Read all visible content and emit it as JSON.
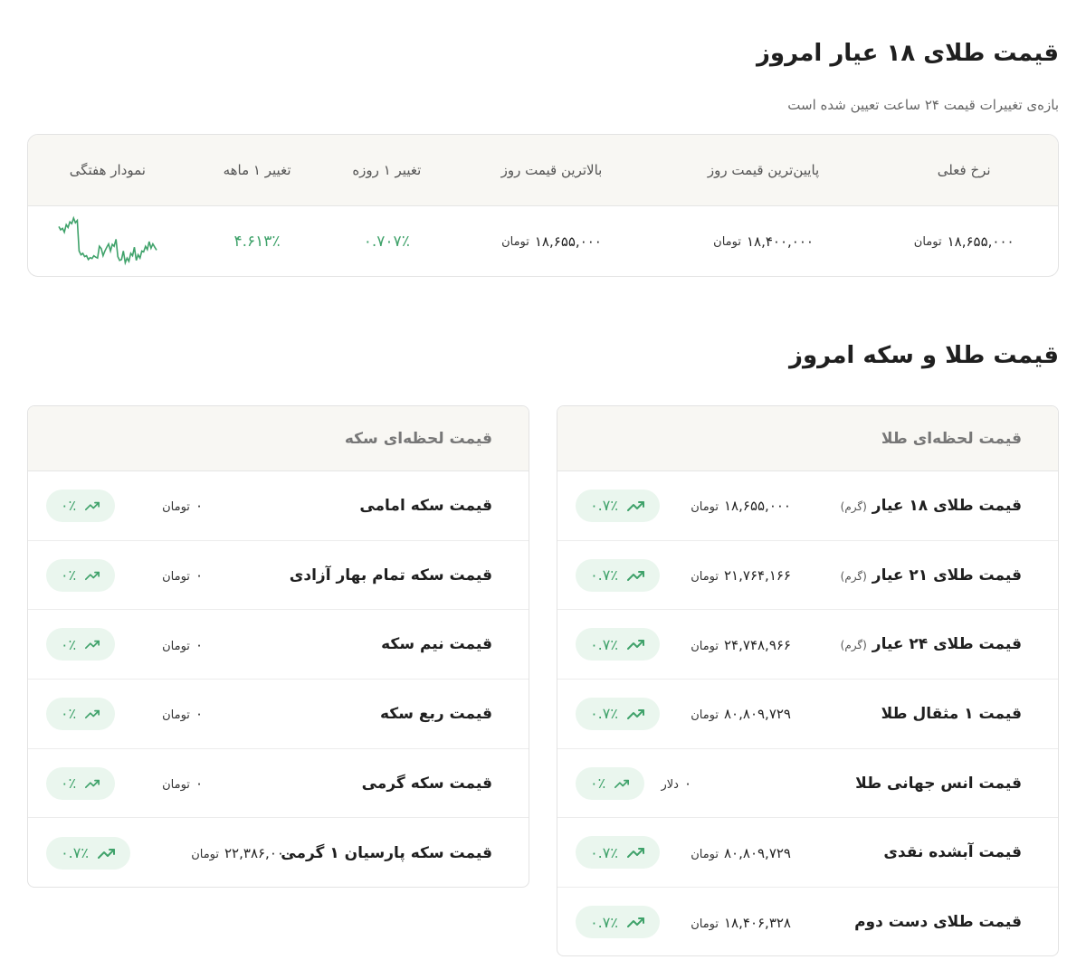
{
  "section1": {
    "title": "قیمت طلای ۱۸ عیار امروز",
    "subtitle": "بازه‌ی تغییرات قیمت ۲۴ ساعت تعیین شده است",
    "headers": {
      "current": "نرخ فعلی",
      "lowest": "پایین‌ترین قیمت روز",
      "highest": "بالاترین قیمت روز",
      "change_day": "تغییر ۱ روزه",
      "change_month": "تغییر ۱ ماهه",
      "weekly_chart": "نمودار هفتگی"
    },
    "row": {
      "current": "۱۸,۶۵۵,۰۰۰",
      "lowest": "۱۸,۴۰۰,۰۰۰",
      "highest": "۱۸,۶۵۵,۰۰۰",
      "unit": "تومان",
      "change_day": "۰.۷۰۷٪",
      "change_month": "۴.۶۱۳٪"
    },
    "sparkline": {
      "color": "#3fa26a",
      "values": [
        0.82,
        0.75,
        0.78,
        0.7,
        0.86,
        0.8,
        0.92,
        0.88,
        1.0,
        0.9,
        0.95,
        0.3,
        0.22,
        0.25,
        0.18,
        0.2,
        0.12,
        0.16,
        0.14,
        0.2,
        0.17,
        0.15,
        0.4,
        0.35,
        0.2,
        0.3,
        0.38,
        0.45,
        0.3,
        0.44,
        0.4,
        0.55,
        0.18,
        0.1,
        0.12,
        0.3,
        0.05,
        0.15,
        0.08,
        0.25,
        0.2,
        0.38,
        0.1,
        0.22,
        0.15,
        0.3,
        0.28,
        0.4,
        0.33,
        0.5,
        0.36,
        0.45,
        0.38,
        0.32
      ]
    }
  },
  "section2": {
    "title": "قیمت طلا و سکه امروز"
  },
  "gold_panel": {
    "title": "قیمت لحظه‌ای طلا",
    "rows": [
      {
        "name": "قیمت طلای ۱۸ عیار",
        "suffix": "(گرم)",
        "price": "۱۸,۶۵۵,۰۰۰",
        "unit": "تومان",
        "change": "۰.۷٪"
      },
      {
        "name": "قیمت طلای ۲۱ عیار",
        "suffix": "(گرم)",
        "price": "۲۱,۷۶۴,۱۶۶",
        "unit": "تومان",
        "change": "۰.۷٪"
      },
      {
        "name": "قیمت طلای ۲۴ عیار",
        "suffix": "(گرم)",
        "price": "۲۴,۷۴۸,۹۶۶",
        "unit": "تومان",
        "change": "۰.۷٪"
      },
      {
        "name": "قیمت ۱ مثقال طلا",
        "suffix": "",
        "price": "۸۰,۸۰۹,۷۲۹",
        "unit": "تومان",
        "change": "۰.۷٪"
      },
      {
        "name": "قیمت انس جهانی طلا",
        "suffix": "",
        "price": "۰",
        "unit": "دلار",
        "change": "۰٪"
      },
      {
        "name": "قیمت آبشده نقدی",
        "suffix": "",
        "price": "۸۰,۸۰۹,۷۲۹",
        "unit": "تومان",
        "change": "۰.۷٪"
      },
      {
        "name": "قیمت طلای دست دوم",
        "suffix": "",
        "price": "۱۸,۴۰۶,۳۲۸",
        "unit": "تومان",
        "change": "۰.۷٪"
      }
    ]
  },
  "coin_panel": {
    "title": "قیمت لحظه‌ای سکه",
    "rows": [
      {
        "name": "قیمت سکه امامی",
        "price": "۰",
        "unit": "تومان",
        "change": "۰٪"
      },
      {
        "name": "قیمت سکه تمام بهار آزادی",
        "price": "۰",
        "unit": "تومان",
        "change": "۰٪"
      },
      {
        "name": "قیمت نیم سکه",
        "price": "۰",
        "unit": "تومان",
        "change": "۰٪"
      },
      {
        "name": "قیمت ربع سکه",
        "price": "۰",
        "unit": "تومان",
        "change": "۰٪"
      },
      {
        "name": "قیمت سکه گرمی",
        "price": "۰",
        "unit": "تومان",
        "change": "۰٪"
      },
      {
        "name": "قیمت سکه پارسیان ۱ گرمی",
        "price": "۲۲,۳۸۶,۰۰۰",
        "unit": "تومان",
        "change": "۰.۷٪"
      }
    ]
  },
  "icons": {
    "trend": "trending-up-icon"
  }
}
